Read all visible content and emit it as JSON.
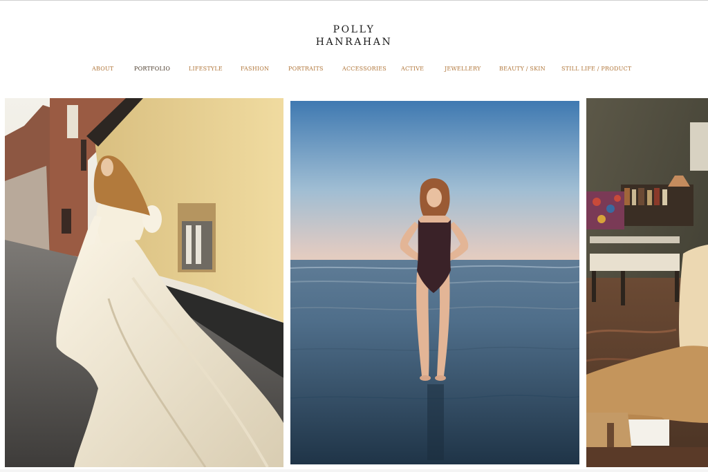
{
  "header": {
    "logo_line1": "POLLY",
    "logo_line2": "HANRAHAN"
  },
  "nav": {
    "items": [
      {
        "label": "ABOUT"
      },
      {
        "label": "PORTFOLIO",
        "active": true
      },
      {
        "label": "LIFESTYLE"
      },
      {
        "label": "FASHION"
      },
      {
        "label": "PORTRAITS"
      },
      {
        "label": "ACCESSORIES"
      },
      {
        "label": "ACTIVE"
      },
      {
        "label": "JEWELLERY"
      },
      {
        "label": "BEAUTY / SKIN"
      },
      {
        "label": "STILL LIFE / PRODUCT"
      }
    ]
  },
  "colors": {
    "nav_link": "#b0763a",
    "nav_active": "#4a3a2a",
    "logo": "#1a1a1a"
  },
  "gallery": {
    "photos": [
      {
        "subject": "woman in white gown on a village street"
      },
      {
        "subject": "woman in dark swimsuit standing at the sea shore"
      },
      {
        "subject": "seated figure in beige clothes in an interior"
      }
    ]
  }
}
